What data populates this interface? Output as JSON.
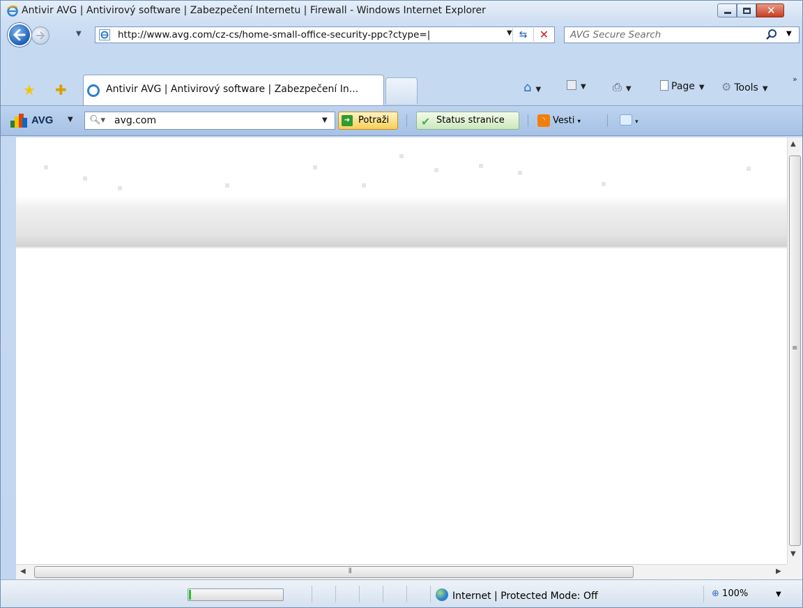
{
  "window": {
    "title": "Antivir AVG | Antivirový software | Zabezpečení Internetu | Firewall - Windows Internet Explorer"
  },
  "address": {
    "url": "http://www.avg.com/cz-cs/home-small-office-security-ppc?ctype=|"
  },
  "search": {
    "placeholder": "AVG Secure Search"
  },
  "tabs": [
    {
      "label": "Antivir AVG | Antivirový software | Zabezpečení In...",
      "active": true
    }
  ],
  "command_bar": {
    "page_label": "Page",
    "tools_label": "Tools"
  },
  "avg_toolbar": {
    "brand": "AVG",
    "search_value": "avg.com",
    "search_button": "Potraži",
    "status_button": "Status stranice",
    "news_button": "Vesti"
  },
  "statusbar": {
    "zone": "Internet | Protected Mode: Off",
    "zoom": "100%",
    "progress": 0.02
  },
  "colors": {
    "accent": "#2a5fa6",
    "close_button": "#c73e20",
    "progress_fill": "#22c522"
  }
}
